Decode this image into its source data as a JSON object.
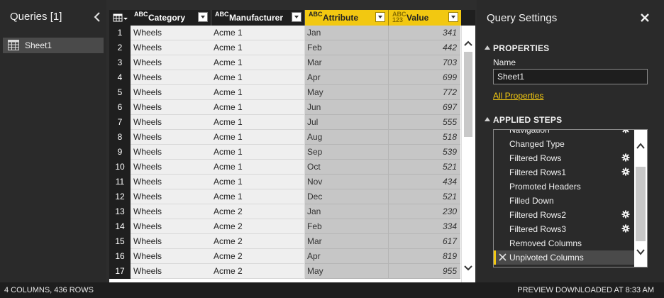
{
  "queries_pane": {
    "title": "Queries [1]",
    "items": [
      {
        "label": "Sheet1"
      }
    ]
  },
  "grid": {
    "columns": [
      {
        "label": "Category",
        "type": "text"
      },
      {
        "label": "Manufacturer",
        "type": "text"
      },
      {
        "label": "Attribute",
        "type": "text",
        "selected": true
      },
      {
        "label": "Value",
        "type": "any"
      }
    ],
    "type_glyphs": {
      "text": "ABC",
      "any": "ABC 123"
    },
    "rows": [
      {
        "num": "1",
        "category": "Wheels",
        "manufacturer": "Acme 1",
        "attribute": "Jan",
        "value": "341"
      },
      {
        "num": "2",
        "category": "Wheels",
        "manufacturer": "Acme 1",
        "attribute": "Feb",
        "value": "442"
      },
      {
        "num": "3",
        "category": "Wheels",
        "manufacturer": "Acme 1",
        "attribute": "Mar",
        "value": "703"
      },
      {
        "num": "4",
        "category": "Wheels",
        "manufacturer": "Acme 1",
        "attribute": "Apr",
        "value": "699"
      },
      {
        "num": "5",
        "category": "Wheels",
        "manufacturer": "Acme 1",
        "attribute": "May",
        "value": "772"
      },
      {
        "num": "6",
        "category": "Wheels",
        "manufacturer": "Acme 1",
        "attribute": "Jun",
        "value": "697"
      },
      {
        "num": "7",
        "category": "Wheels",
        "manufacturer": "Acme 1",
        "attribute": "Jul",
        "value": "555"
      },
      {
        "num": "8",
        "category": "Wheels",
        "manufacturer": "Acme 1",
        "attribute": "Aug",
        "value": "518"
      },
      {
        "num": "9",
        "category": "Wheels",
        "manufacturer": "Acme 1",
        "attribute": "Sep",
        "value": "539"
      },
      {
        "num": "10",
        "category": "Wheels",
        "manufacturer": "Acme 1",
        "attribute": "Oct",
        "value": "521"
      },
      {
        "num": "11",
        "category": "Wheels",
        "manufacturer": "Acme 1",
        "attribute": "Nov",
        "value": "434"
      },
      {
        "num": "12",
        "category": "Wheels",
        "manufacturer": "Acme 1",
        "attribute": "Dec",
        "value": "521"
      },
      {
        "num": "13",
        "category": "Wheels",
        "manufacturer": "Acme 2",
        "attribute": "Jan",
        "value": "230"
      },
      {
        "num": "14",
        "category": "Wheels",
        "manufacturer": "Acme 2",
        "attribute": "Feb",
        "value": "334"
      },
      {
        "num": "15",
        "category": "Wheels",
        "manufacturer": "Acme 2",
        "attribute": "Mar",
        "value": "617"
      },
      {
        "num": "16",
        "category": "Wheels",
        "manufacturer": "Acme 2",
        "attribute": "Apr",
        "value": "819"
      },
      {
        "num": "17",
        "category": "Wheels",
        "manufacturer": "Acme 2",
        "attribute": "May",
        "value": "955"
      }
    ]
  },
  "settings": {
    "title": "Query Settings",
    "properties": {
      "title": "PROPERTIES",
      "name_label": "Name",
      "name_value": "Sheet1",
      "all_properties_link": "All Properties"
    },
    "applied_steps": {
      "title": "APPLIED STEPS",
      "steps": [
        {
          "label": "Navigation",
          "gear": true,
          "active": false
        },
        {
          "label": "Changed Type",
          "gear": false,
          "active": false
        },
        {
          "label": "Filtered Rows",
          "gear": true,
          "active": false
        },
        {
          "label": "Filtered Rows1",
          "gear": true,
          "active": false
        },
        {
          "label": "Promoted Headers",
          "gear": false,
          "active": false
        },
        {
          "label": "Filled Down",
          "gear": false,
          "active": false
        },
        {
          "label": "Filtered Rows2",
          "gear": true,
          "active": false
        },
        {
          "label": "Filtered Rows3",
          "gear": true,
          "active": false
        },
        {
          "label": "Removed Columns",
          "gear": false,
          "active": false
        },
        {
          "label": "Unpivoted Columns",
          "gear": false,
          "active": true
        }
      ]
    }
  },
  "statusbar": {
    "left": "4 COLUMNS, 436 ROWS",
    "right": "PREVIEW DOWNLOADED AT 8:33 AM"
  },
  "colors": {
    "accent": "#f2c811",
    "dark_background": "#2a2a2a",
    "grid_header": "#1f1f1f",
    "selected_column_cells": "#c6c6c6"
  }
}
